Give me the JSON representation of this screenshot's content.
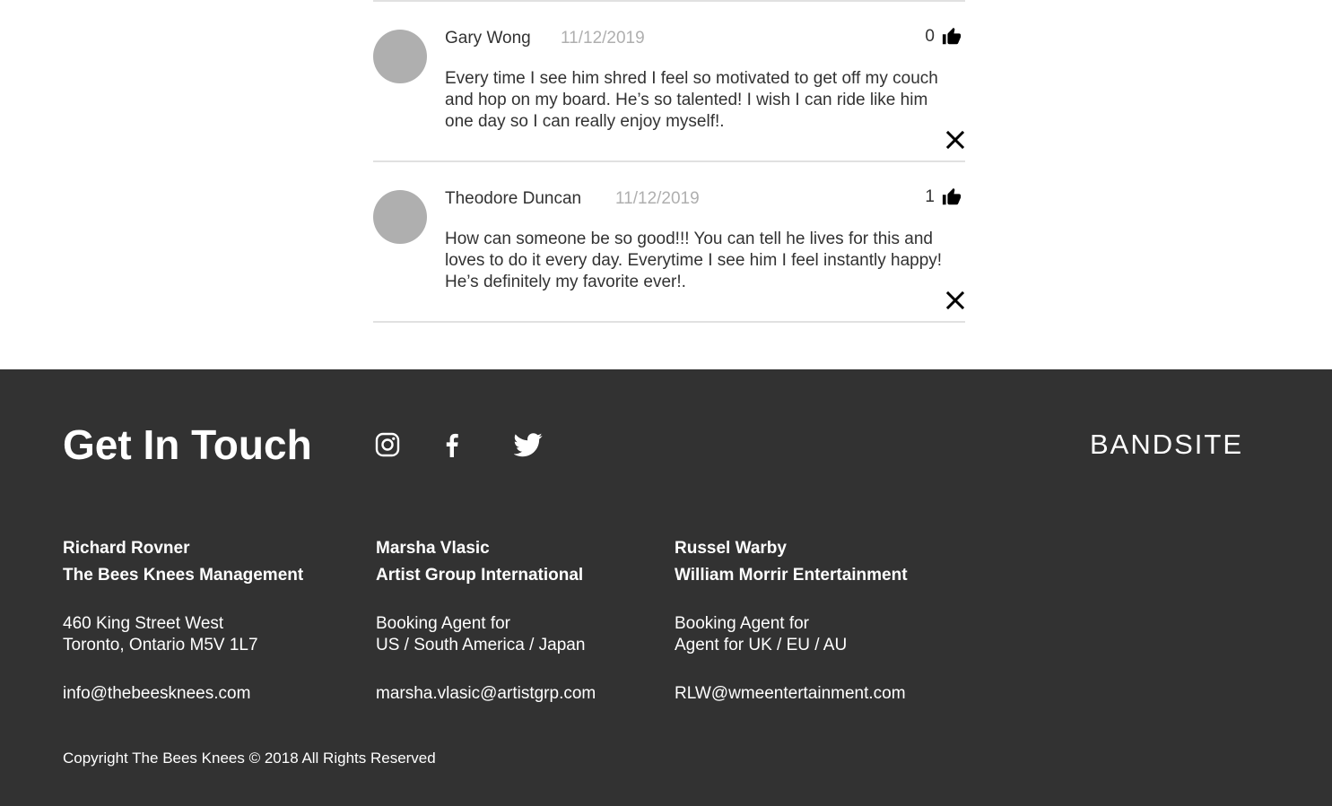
{
  "comments": [
    {
      "name": "Gary Wong",
      "date": "11/12/2019",
      "likes": "0",
      "text": "Every time I see him shred I feel so motivated to get off my couch and hop on my board. He’s so talented! I wish I can ride like him one day so I can really enjoy myself!."
    },
    {
      "name": "Theodore Duncan",
      "date": "11/12/2019",
      "likes": "1",
      "text": "How can someone be so good!!! You can tell he lives for this and loves to do it every day. Everytime I see him I feel instantly happy! He’s definitely my favorite ever!."
    }
  ],
  "footer": {
    "title": "Get In Touch",
    "brand": "BANDSITE",
    "social_icons": [
      "instagram-icon",
      "facebook-icon",
      "twitter-icon"
    ],
    "contacts": [
      {
        "name": "Richard Rovner",
        "company": "The Bees Knees Management",
        "line1": "460 King Street West",
        "line2": "Toronto, Ontario M5V 1L7",
        "email": "info@thebeesknees.com"
      },
      {
        "name": "Marsha Vlasic",
        "company": "Artist Group International",
        "line1": "Booking Agent for",
        "line2": "US / South America / Japan",
        "email": "marsha.vlasic@artistgrp.com"
      },
      {
        "name": "Russel Warby",
        "company": "William Morrir Entertainment",
        "line1": "Booking Agent for",
        "line2": "Agent for UK / EU / AU",
        "email": "RLW@wmeentertainment.com"
      }
    ],
    "copyright": "Copyright The Bees Knees © 2018 All Rights Reserved"
  },
  "colors": {
    "text_dark": "#323232",
    "text_muted": "#afafaf",
    "avatar": "#afafaf",
    "divider": "#e1e1e1",
    "footer_bg": "#323232",
    "footer_text": "#ffffff"
  }
}
